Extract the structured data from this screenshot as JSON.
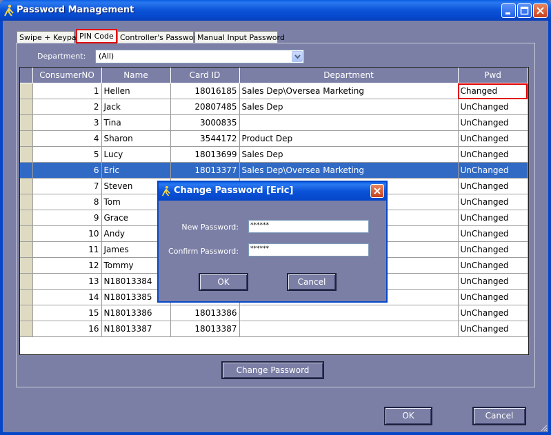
{
  "window": {
    "title": "Password Management"
  },
  "tabs": [
    {
      "label": "Swipe + Keypad"
    },
    {
      "label": "PIN Code"
    },
    {
      "label": "Controller's Password"
    },
    {
      "label": "Manual Input Password"
    }
  ],
  "filter": {
    "label": "Department:",
    "value": "(All)"
  },
  "table": {
    "columns": [
      "ConsumerNO",
      "Name",
      "Card ID",
      "Department",
      "Pwd"
    ],
    "rows": [
      {
        "no": "1",
        "name": "Hellen",
        "card": "18016185",
        "dept": "Sales Dep\\Oversea Marketing",
        "pwd": "Changed"
      },
      {
        "no": "2",
        "name": "Jack",
        "card": "20807485",
        "dept": "Sales Dep",
        "pwd": "UnChanged"
      },
      {
        "no": "3",
        "name": "Tina",
        "card": "3000835",
        "dept": "",
        "pwd": "UnChanged"
      },
      {
        "no": "4",
        "name": "Sharon",
        "card": "3544172",
        "dept": "Product Dep",
        "pwd": "UnChanged"
      },
      {
        "no": "5",
        "name": "Lucy",
        "card": "18013699",
        "dept": "Sales Dep",
        "pwd": "UnChanged"
      },
      {
        "no": "6",
        "name": "Eric",
        "card": "18013377",
        "dept": "Sales Dep\\Oversea Marketing",
        "pwd": "UnChanged"
      },
      {
        "no": "7",
        "name": "Steven",
        "card": "",
        "dept": "",
        "pwd": "UnChanged"
      },
      {
        "no": "8",
        "name": "Tom",
        "card": "",
        "dept": "",
        "pwd": "UnChanged"
      },
      {
        "no": "9",
        "name": "Grace",
        "card": "",
        "dept": "",
        "pwd": "UnChanged"
      },
      {
        "no": "10",
        "name": "Andy",
        "card": "",
        "dept": "",
        "pwd": "UnChanged"
      },
      {
        "no": "11",
        "name": "James",
        "card": "",
        "dept": "",
        "pwd": "UnChanged"
      },
      {
        "no": "12",
        "name": "Tommy",
        "card": "",
        "dept": "",
        "pwd": "UnChanged"
      },
      {
        "no": "13",
        "name": "N18013384",
        "card": "",
        "dept": "",
        "pwd": "UnChanged"
      },
      {
        "no": "14",
        "name": "N18013385",
        "card": "",
        "dept": "",
        "pwd": "UnChanged"
      },
      {
        "no": "15",
        "name": "N18013386",
        "card": "18013386",
        "dept": "",
        "pwd": "UnChanged"
      },
      {
        "no": "16",
        "name": "N18013387",
        "card": "18013387",
        "dept": "",
        "pwd": "UnChanged"
      }
    ],
    "selected_row": 5,
    "highlighted_pwd_row": 0
  },
  "buttons": {
    "change_password": "Change Password",
    "ok": "OK",
    "cancel": "Cancel"
  },
  "dialog": {
    "title": "Change Password  [Eric]",
    "new_password_label": "New Password:",
    "new_password_value": "******",
    "confirm_password_label": "Confirm Password:",
    "confirm_password_value": "******",
    "ok": "OK",
    "cancel": "Cancel"
  },
  "colors": {
    "background": "#7b7fa6",
    "titlebar": "#0546c8",
    "selected_row": "#316ac5",
    "highlight": "#e00000"
  }
}
